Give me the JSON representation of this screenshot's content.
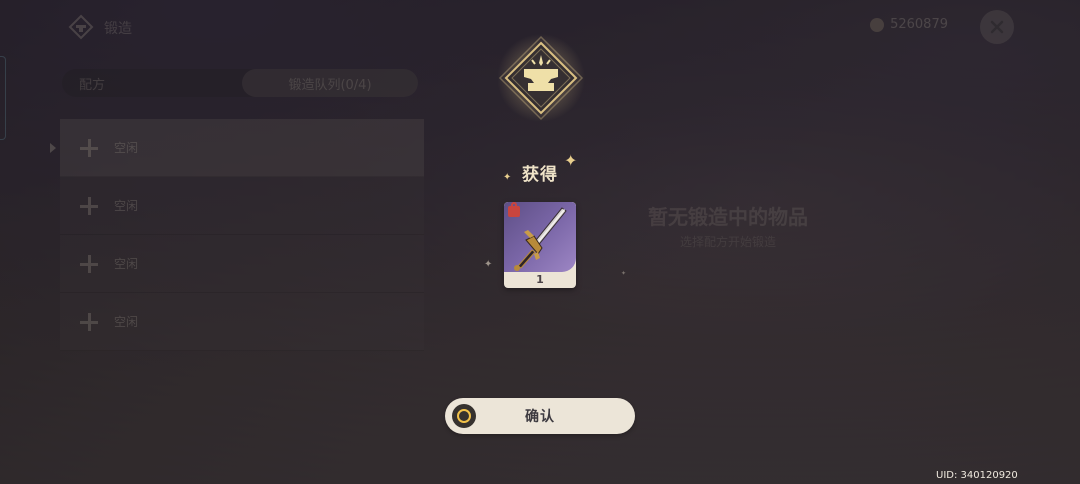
{
  "topbar": {
    "title": "锻造",
    "currency_amount": "5260879"
  },
  "tabs": [
    {
      "label": "配方"
    },
    {
      "label": "锻造队列(0/4)"
    }
  ],
  "queue": {
    "slots": [
      {
        "label": "空闲"
      },
      {
        "label": "空闲"
      },
      {
        "label": "空闲"
      },
      {
        "label": "空闲"
      }
    ]
  },
  "empty_state": {
    "title": "暂无锻造中的物品",
    "subtitle": "选择配方开始锻造"
  },
  "reward": {
    "title": "获得",
    "item": {
      "count": "1",
      "icon": "sword-icon",
      "locked": true
    }
  },
  "confirm": {
    "label": "确认"
  },
  "uid": "UID: 340120920",
  "colors": {
    "accent_gold": "#e9cf8e",
    "card_purple": "#7a66a7",
    "button_bg": "#ece5d8",
    "lock_red": "#c9453e"
  }
}
